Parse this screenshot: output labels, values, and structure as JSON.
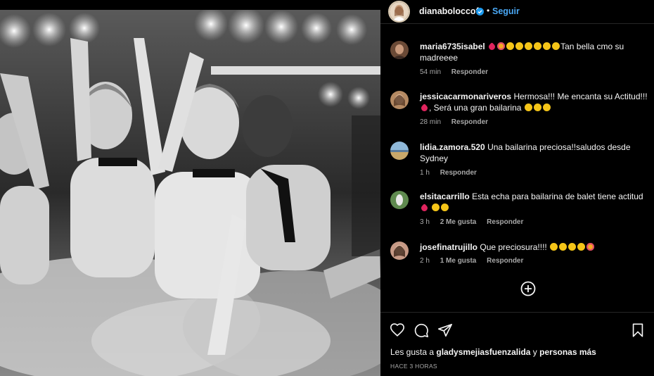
{
  "post": {
    "username": "dianaboloccof",
    "separator": "•",
    "follow_label": "Seguir"
  },
  "comments": [
    {
      "username": "maria6735isabel",
      "text_parts": [
        "",
        "Tan bella cmo su madreeee"
      ],
      "emojis_before": [
        "heart",
        "star",
        "clap",
        "clap",
        "clap",
        "clap",
        "clap",
        "clap"
      ],
      "time": "54 min",
      "likes": "",
      "reply_label": "Responder"
    },
    {
      "username": "jessicacarmonariveros",
      "text": "Hermosa!!! Me encanta su Actitud!!!",
      "text2": ", Será una gran bailarina",
      "time": "28 min",
      "likes": "",
      "reply_label": "Responder"
    },
    {
      "username": "lidia.zamora.520",
      "text": "Una bailarina preciosa!!saludos desde Sydney",
      "time": "1 h",
      "likes": "",
      "reply_label": "Responder"
    },
    {
      "username": "elsitacarrillo",
      "text": "Esta echa para bailarina de balet tiene actitud",
      "time": "3 h",
      "likes": "2 Me gusta",
      "reply_label": "Responder"
    },
    {
      "username": "josefinatrujillo",
      "text": "Que preciosura!!!!",
      "time": "2 h",
      "likes": "1 Me gusta",
      "reply_label": "Responder"
    }
  ],
  "actions": {
    "icons": [
      "heart-icon",
      "comment-icon",
      "share-icon",
      "bookmark-icon"
    ]
  },
  "likes": {
    "prefix": "Les gusta a",
    "user": "gladysmejiasfuenzalida",
    "connector": "y",
    "others": "personas más"
  },
  "timestamp": "HACE 3 HORAS",
  "colors": {
    "background": "#000000",
    "link": "#4aa8f5",
    "muted": "#a8a8a8",
    "divider": "#262626"
  }
}
